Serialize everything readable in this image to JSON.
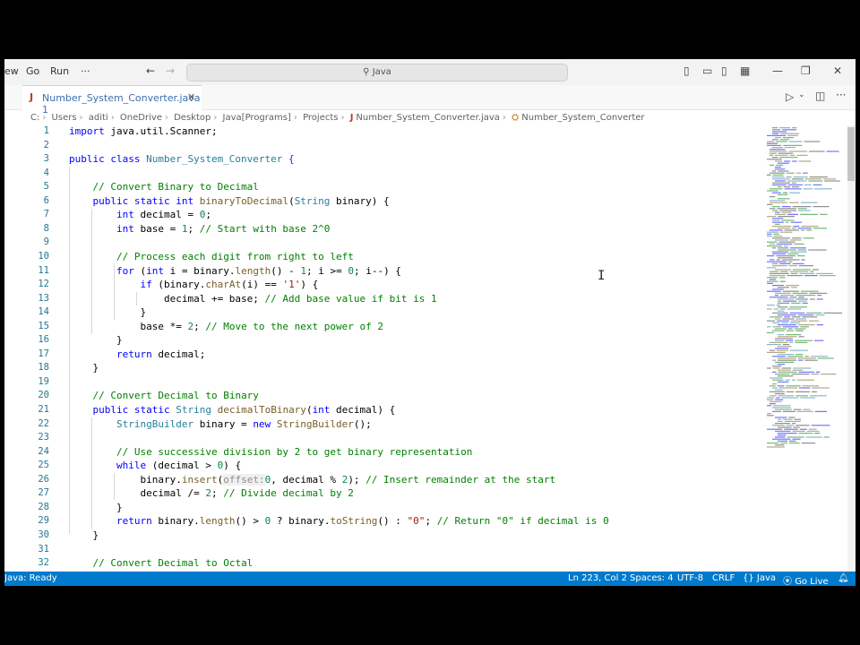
{
  "menu": [
    "ew",
    "Go",
    "Run",
    "···"
  ],
  "search": {
    "label": "Java"
  },
  "tab": {
    "name": "Number_System_Converter.java",
    "problems": "1"
  },
  "breadcrumbs": [
    "C:",
    "Users",
    "aditi",
    "OneDrive",
    "Desktop",
    "Java[Programs]",
    "Projects",
    "Number_System_Converter.java",
    "Number_System_Converter"
  ],
  "status": {
    "java_ready": "Java: Ready",
    "position": "Ln 223, Col 2",
    "spaces": "Spaces: 4",
    "encoding": "UTF-8",
    "eol": "CRLF",
    "language": "{} Java",
    "golive": "Go Live"
  },
  "code": [
    {
      "n": "1",
      "segs": [
        [
          "kw",
          "import"
        ],
        [
          "tx",
          " java.util.Scanner;"
        ]
      ]
    },
    {
      "n": "2",
      "segs": []
    },
    {
      "n": "3",
      "segs": [
        [
          "kw",
          "public class "
        ],
        [
          "ty",
          "Number_System_Converter"
        ],
        [
          "tx",
          " "
        ],
        [
          "br1",
          "{"
        ]
      ]
    },
    {
      "n": "4",
      "segs": []
    },
    {
      "n": "5",
      "segs": [
        [
          "tx",
          "    "
        ],
        [
          "cm",
          "// Convert Binary to Decimal"
        ]
      ]
    },
    {
      "n": "6",
      "segs": [
        [
          "tx",
          "    "
        ],
        [
          "kw",
          "public static int "
        ],
        [
          "fn",
          "binaryToDecimal"
        ],
        [
          "tx",
          "("
        ],
        [
          "ty",
          "String"
        ],
        [
          "tx",
          " binary) {"
        ]
      ]
    },
    {
      "n": "7",
      "segs": [
        [
          "tx",
          "        "
        ],
        [
          "kw",
          "int"
        ],
        [
          "tx",
          " decimal = "
        ],
        [
          "nm",
          "0"
        ],
        [
          "tx",
          ";"
        ]
      ]
    },
    {
      "n": "8",
      "segs": [
        [
          "tx",
          "        "
        ],
        [
          "kw",
          "int"
        ],
        [
          "tx",
          " base = "
        ],
        [
          "nm",
          "1"
        ],
        [
          "tx",
          "; "
        ],
        [
          "cm",
          "// Start with base 2^0"
        ]
      ]
    },
    {
      "n": "9",
      "segs": []
    },
    {
      "n": "10",
      "segs": [
        [
          "tx",
          "        "
        ],
        [
          "cm",
          "// Process each digit from right to left"
        ]
      ]
    },
    {
      "n": "11",
      "segs": [
        [
          "tx",
          "        "
        ],
        [
          "kw",
          "for"
        ],
        [
          "tx",
          " ("
        ],
        [
          "kw",
          "int"
        ],
        [
          "tx",
          " i = binary."
        ],
        [
          "fn",
          "length"
        ],
        [
          "tx",
          "() - "
        ],
        [
          "nm",
          "1"
        ],
        [
          "tx",
          "; i >= "
        ],
        [
          "nm",
          "0"
        ],
        [
          "tx",
          "; i--) {"
        ]
      ]
    },
    {
      "n": "12",
      "segs": [
        [
          "tx",
          "            "
        ],
        [
          "kw",
          "if"
        ],
        [
          "tx",
          " (binary."
        ],
        [
          "fn",
          "charAt"
        ],
        [
          "tx",
          "(i) == "
        ],
        [
          "st",
          "'1'"
        ],
        [
          "tx",
          ") {"
        ]
      ]
    },
    {
      "n": "13",
      "segs": [
        [
          "tx",
          "                decimal += base; "
        ],
        [
          "cm",
          "// Add base value if bit is 1"
        ]
      ]
    },
    {
      "n": "14",
      "segs": [
        [
          "tx",
          "            }"
        ]
      ]
    },
    {
      "n": "15",
      "segs": [
        [
          "tx",
          "            base *= "
        ],
        [
          "nm",
          "2"
        ],
        [
          "tx",
          "; "
        ],
        [
          "cm",
          "// Move to the next power of 2"
        ]
      ]
    },
    {
      "n": "16",
      "segs": [
        [
          "tx",
          "        }"
        ]
      ]
    },
    {
      "n": "17",
      "segs": [
        [
          "tx",
          "        "
        ],
        [
          "kw",
          "return"
        ],
        [
          "tx",
          " decimal;"
        ]
      ]
    },
    {
      "n": "18",
      "segs": [
        [
          "tx",
          "    }"
        ]
      ]
    },
    {
      "n": "19",
      "segs": []
    },
    {
      "n": "20",
      "segs": [
        [
          "tx",
          "    "
        ],
        [
          "cm",
          "// Convert Decimal to Binary"
        ]
      ]
    },
    {
      "n": "21",
      "segs": [
        [
          "tx",
          "    "
        ],
        [
          "kw",
          "public static "
        ],
        [
          "ty",
          "String"
        ],
        [
          "tx",
          " "
        ],
        [
          "fn",
          "decimalToBinary"
        ],
        [
          "tx",
          "("
        ],
        [
          "kw",
          "int"
        ],
        [
          "tx",
          " decimal) {"
        ]
      ]
    },
    {
      "n": "22",
      "segs": [
        [
          "tx",
          "        "
        ],
        [
          "ty",
          "StringBuilder"
        ],
        [
          "tx",
          " binary = "
        ],
        [
          "kw",
          "new"
        ],
        [
          "tx",
          " "
        ],
        [
          "fn",
          "StringBuilder"
        ],
        [
          "tx",
          "();"
        ]
      ]
    },
    {
      "n": "23",
      "segs": []
    },
    {
      "n": "24",
      "segs": [
        [
          "tx",
          "        "
        ],
        [
          "cm",
          "// Use successive division by 2 to get binary representation"
        ]
      ]
    },
    {
      "n": "25",
      "segs": [
        [
          "tx",
          "        "
        ],
        [
          "kw",
          "while"
        ],
        [
          "tx",
          " (decimal > "
        ],
        [
          "nm",
          "0"
        ],
        [
          "tx",
          ") {"
        ]
      ]
    },
    {
      "n": "26",
      "segs": [
        [
          "tx",
          "            binary."
        ],
        [
          "fn",
          "insert"
        ],
        [
          "tx",
          "("
        ],
        [
          "hint",
          "offset:"
        ],
        [
          "nm",
          "0"
        ],
        [
          "tx",
          ", decimal % "
        ],
        [
          "nm",
          "2"
        ],
        [
          "tx",
          "); "
        ],
        [
          "cm",
          "// Insert remainder at the start"
        ]
      ]
    },
    {
      "n": "27",
      "segs": [
        [
          "tx",
          "            decimal /= "
        ],
        [
          "nm",
          "2"
        ],
        [
          "tx",
          "; "
        ],
        [
          "cm",
          "// Divide decimal by 2"
        ]
      ]
    },
    {
      "n": "28",
      "segs": [
        [
          "tx",
          "        }"
        ]
      ]
    },
    {
      "n": "29",
      "segs": [
        [
          "tx",
          "        "
        ],
        [
          "kw",
          "return"
        ],
        [
          "tx",
          " binary."
        ],
        [
          "fn",
          "length"
        ],
        [
          "tx",
          "() > "
        ],
        [
          "nm",
          "0"
        ],
        [
          "tx",
          " ? binary."
        ],
        [
          "fn",
          "toString"
        ],
        [
          "tx",
          "() : "
        ],
        [
          "st",
          "\"0\""
        ],
        [
          "tx",
          "; "
        ],
        [
          "cm",
          "// Return \"0\" if decimal is 0"
        ]
      ]
    },
    {
      "n": "30",
      "segs": [
        [
          "tx",
          "    }"
        ]
      ]
    },
    {
      "n": "31",
      "segs": []
    },
    {
      "n": "32",
      "segs": [
        [
          "tx",
          "    "
        ],
        [
          "cm",
          "// Convert Decimal to Octal"
        ]
      ]
    }
  ]
}
